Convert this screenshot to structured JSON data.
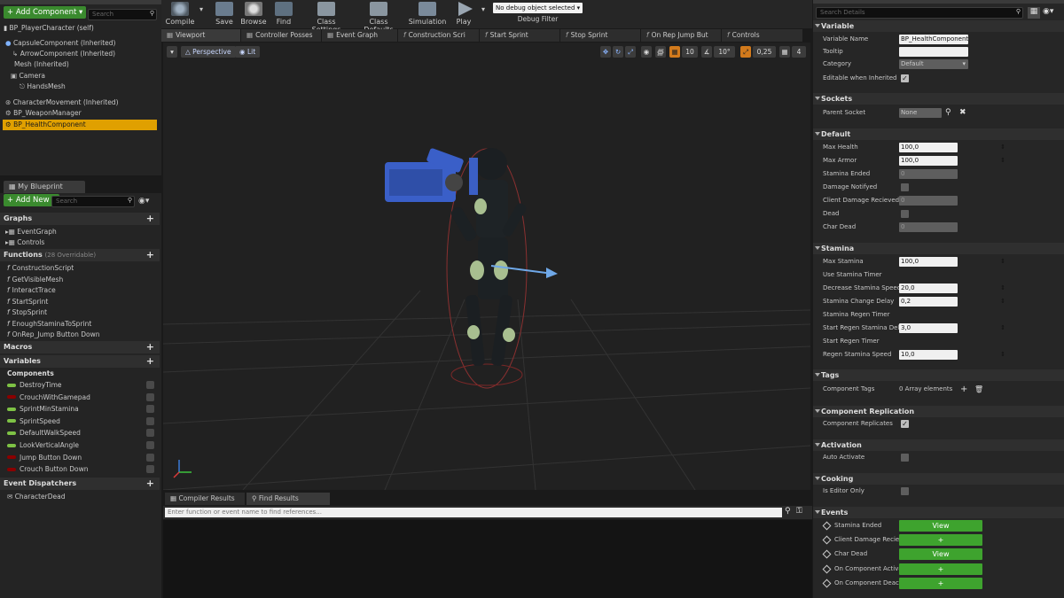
{
  "components_panel": {
    "add_button": "+ Add Component ▾",
    "search_placeholder": "Search",
    "items": [
      "BP_PlayerCharacter (self)",
      "CapsuleComponent (Inherited)",
      "ArrowComponent (Inherited)",
      "Mesh (Inherited)",
      "Camera",
      "HandsMesh",
      "CharacterMovement (Inherited)",
      "BP_WeaponManager",
      "BP_HealthComponent"
    ]
  },
  "my_blueprint": {
    "tab_label": "My Blueprint",
    "add_new": "+ Add New ▾",
    "search_placeholder": "Search",
    "graphs_label": "Graphs",
    "graph_items": [
      "EventGraph",
      "Controls"
    ],
    "functions_label": "Functions",
    "functions_overridable": "(28 Overridable)",
    "function_items": [
      "ConstructionScript",
      "GetVisibleMesh",
      "InteractTrace",
      "StartSprint",
      "StopSprint",
      "EnoughStaminaToSprint",
      "OnRep_Jump Button Down"
    ],
    "macros_label": "Macros",
    "variables_label": "Variables",
    "components_label": "Components",
    "variable_items": [
      {
        "name": "DestroyTime",
        "color": "#7ec245"
      },
      {
        "name": "CrouchWithGamepad",
        "color": "#8a0000"
      },
      {
        "name": "SprintMinStamina",
        "color": "#7ec245"
      },
      {
        "name": "SprintSpeed",
        "color": "#7ec245"
      },
      {
        "name": "DefaultWalkSpeed",
        "color": "#7ec245"
      },
      {
        "name": "LookVerticalAngle",
        "color": "#7ec245"
      },
      {
        "name": "Jump Button Down",
        "color": "#8a0000"
      },
      {
        "name": "Crouch Button Down",
        "color": "#8a0000"
      }
    ],
    "event_dispatchers_label": "Event Dispatchers",
    "dispatcher_items": [
      "CharacterDead"
    ]
  },
  "toolbar": {
    "compile": "Compile",
    "save": "Save",
    "browse": "Browse",
    "find": "Find",
    "class_settings": "Class Settings",
    "class_defaults": "Class Defaults",
    "simulation": "Simulation",
    "play": "Play",
    "debug_select": "No debug object selected ▾",
    "debug_filter": "Debug Filter"
  },
  "doc_tabs": [
    "Viewport",
    "Controller Posses",
    "Event Graph",
    "Construction Scri",
    "Start Sprint",
    "Stop Sprint",
    "On Rep Jump But",
    "Controls"
  ],
  "viewport": {
    "perspective": "Perspective",
    "lit": "Lit",
    "snap_grid": "10",
    "snap_rot": "10°",
    "snap_scale": "0,25",
    "cam_speed": "4"
  },
  "bottom": {
    "tabs": [
      "Compiler Results",
      "Find Results"
    ],
    "find_placeholder": "Enter function or event name to find references..."
  },
  "details": {
    "search_placeholder": "Search Details",
    "sections": {
      "variable": "Variable",
      "sockets": "Sockets",
      "default": "Default",
      "stamina": "Stamina",
      "tags": "Tags",
      "component_replication": "Component Replication",
      "activation": "Activation",
      "cooking": "Cooking",
      "events": "Events"
    },
    "variable_name_label": "Variable Name",
    "variable_name_value": "BP_HealthComponent",
    "tooltip_label": "Tooltip",
    "category_label": "Category",
    "category_value": "Default",
    "editable_label": "Editable when Inherited",
    "parent_socket_label": "Parent Socket",
    "parent_socket_value": "None",
    "default_rows": [
      {
        "label": "Max Health",
        "value": "100,0",
        "kind": "num"
      },
      {
        "label": "Max Armor",
        "value": "100,0",
        "kind": "num"
      },
      {
        "label": "Stamina Ended",
        "value": "0",
        "kind": "gray"
      },
      {
        "label": "Damage Notifyed",
        "value": "",
        "kind": "chk"
      },
      {
        "label": "Client Damage Recieved",
        "value": "0",
        "kind": "gray"
      },
      {
        "label": "Dead",
        "value": "",
        "kind": "chk"
      },
      {
        "label": "Char Dead",
        "value": "0",
        "kind": "gray"
      }
    ],
    "stamina_rows": [
      {
        "label": "Max Stamina",
        "value": "100,0",
        "kind": "num"
      },
      {
        "label": "Use Stamina Timer",
        "value": "",
        "kind": "none"
      },
      {
        "label": "Decrease Stamina Speed",
        "value": "20,0",
        "kind": "num"
      },
      {
        "label": "Stamina Change Delay",
        "value": "0,2",
        "kind": "num"
      },
      {
        "label": "Stamina Regen Timer",
        "value": "",
        "kind": "none"
      },
      {
        "label": "Start Regen Stamina Delay",
        "value": "3,0",
        "kind": "num"
      },
      {
        "label": "Start Regen Timer",
        "value": "",
        "kind": "none"
      },
      {
        "label": "Regen Stamina Speed",
        "value": "10,0",
        "kind": "num"
      }
    ],
    "component_tags_label": "Component Tags",
    "component_tags_value": "0 Array elements",
    "component_replicates_label": "Component Replicates",
    "auto_activate_label": "Auto Activate",
    "is_editor_only_label": "Is Editor Only",
    "event_rows": [
      {
        "label": "Stamina Ended",
        "button": "View"
      },
      {
        "label": "Client Damage Reciev",
        "button": "+"
      },
      {
        "label": "Char Dead",
        "button": "View"
      },
      {
        "label": "On Component Activat",
        "button": "+"
      },
      {
        "label": "On Component Deactiv",
        "button": "+"
      }
    ]
  }
}
